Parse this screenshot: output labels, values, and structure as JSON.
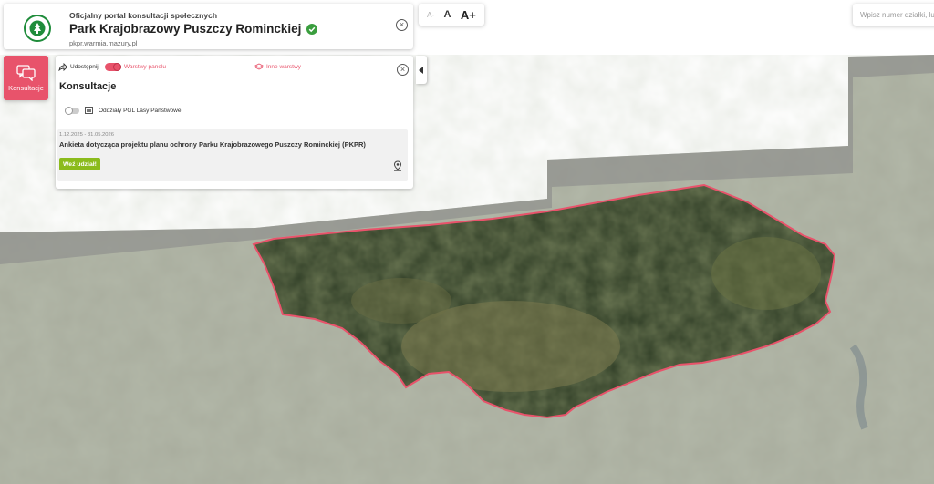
{
  "header": {
    "portal_subtitle": "Oficjalny portal konsultacji społecznych",
    "park_title": "Park Krajobrazowy Puszczy Rominckiej",
    "url": "pkpr.warmia.mazury.pl"
  },
  "font_controls": {
    "decrease": "A-",
    "normal": "A",
    "increase": "A+"
  },
  "search": {
    "placeholder": "Wpisz numer działki, lub"
  },
  "sidebar": {
    "konsultacje_label": "Konsultacje"
  },
  "panel": {
    "share_label": "Udostępnij",
    "layers_panel_label": "Warstwy panelu",
    "other_layers_label": "Inne warstwy",
    "title": "Konsultacje",
    "layer_name": "Oddziały PGL Lasy Państwowe",
    "consultation": {
      "dates": "1.12.2025 - 31.05.2026",
      "title": "Ankieta dotycząca projektu planu ochrony Parku Krajobrazowego Puszczy Rominckiej (PKPR)",
      "button_label": "Weź udział!"
    }
  },
  "colors": {
    "accent": "#e8536b",
    "brand_green": "#1f8c3b",
    "button_green": "#8bbb1c"
  }
}
